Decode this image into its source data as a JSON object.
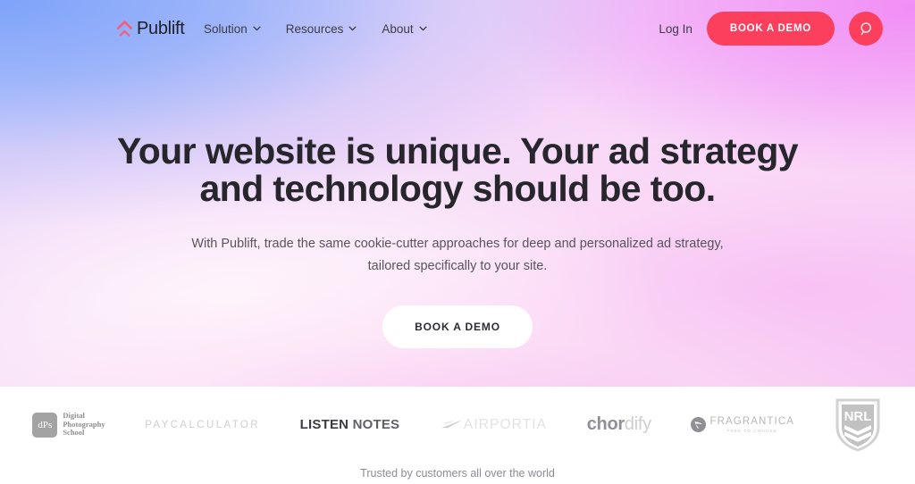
{
  "brand": {
    "name": "Publift",
    "mark_icon": "double-chevron-up-icon",
    "mark_color": "#fb5a74"
  },
  "nav": {
    "items": [
      {
        "label": "Solution",
        "icon": "chevron-down-icon"
      },
      {
        "label": "Resources",
        "icon": "chevron-down-icon"
      },
      {
        "label": "About",
        "icon": "chevron-down-icon"
      }
    ]
  },
  "header": {
    "login_label": "Log In",
    "demo_label": "BOOK A DEMO",
    "search_icon": "search-icon",
    "accent_color": "#fb3f5c"
  },
  "hero": {
    "title_line1": "Your website is unique. Your ad strategy",
    "title_line2": "and technology should be too.",
    "subtitle_line1": "With Publift, trade the same cookie-cutter approaches for deep and personalized ad strategy,",
    "subtitle_line2": "tailored specifically to your site.",
    "cta_label": "BOOK A DEMO"
  },
  "logos": {
    "dps": {
      "badge": "dPs",
      "line1": "Digital",
      "line2": "Photography",
      "line3": "School"
    },
    "paycalculator": "PAYCALCULATOR",
    "listennotes": {
      "word1": "LISTEN",
      "word2": "NOTES"
    },
    "airportia": {
      "text": "AIRPORTIA",
      "icon": "airplane-mark-icon"
    },
    "chordify": {
      "prefix": "ch",
      "mid": "or",
      "suffix": "dify"
    },
    "fragrantica": {
      "name": "FRAGRANTICA",
      "tagline": "FREE TO CHOOSE",
      "icon": "circle-leaf-icon"
    },
    "nrl": {
      "text": "NRL",
      "icon": "nrl-shield-icon"
    }
  },
  "footer": {
    "trusted_text": "Trusted by customers all over the world"
  }
}
